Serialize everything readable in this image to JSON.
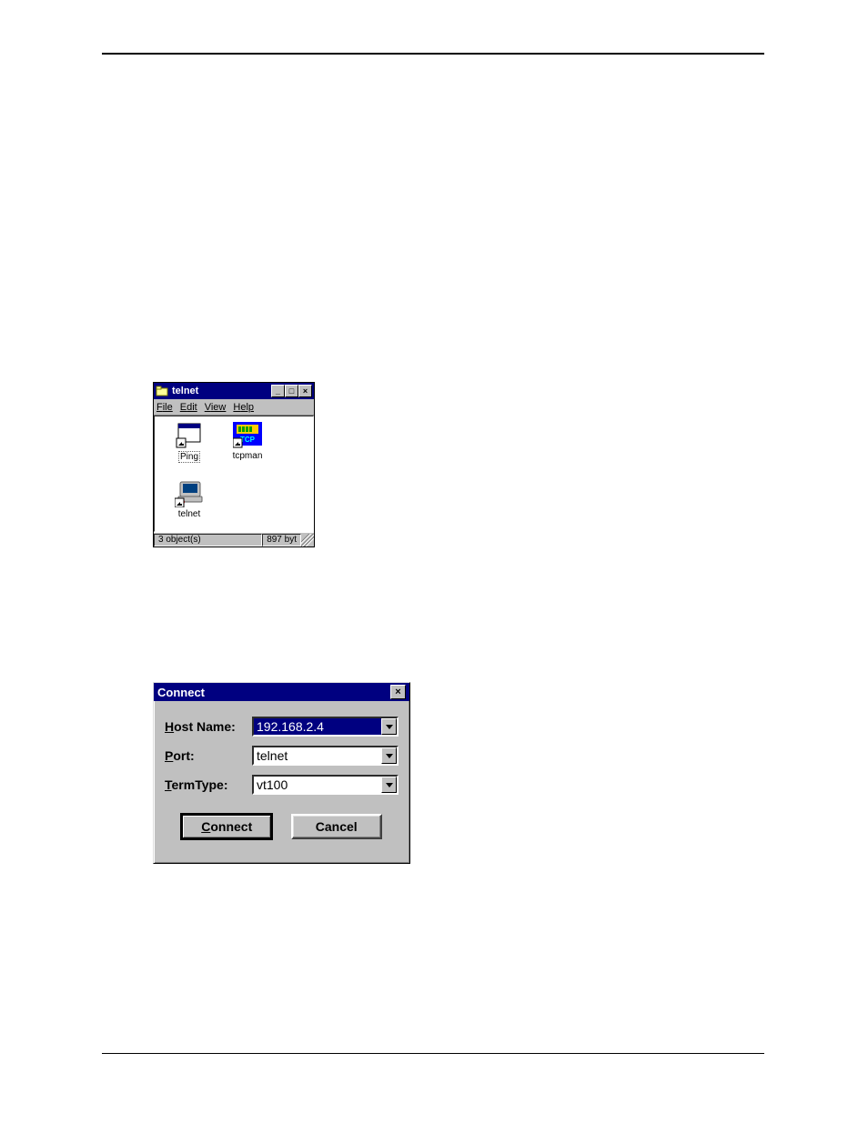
{
  "folder": {
    "title": "telnet",
    "menus": [
      {
        "accel": "F",
        "rest": "ile"
      },
      {
        "accel": "E",
        "rest": "dit"
      },
      {
        "accel": "V",
        "rest": "iew"
      },
      {
        "accel": "H",
        "rest": "elp"
      }
    ],
    "window_buttons": {
      "min": "_",
      "max": "□",
      "close": "×"
    },
    "items": [
      {
        "name": "Ping",
        "icon": "window-shortcut",
        "selected_label": true
      },
      {
        "name": "tcpman",
        "icon": "tcp-shortcut",
        "highlighted_icon": true
      },
      {
        "name": "telnet",
        "icon": "terminal-shortcut"
      }
    ],
    "status_left": "3 object(s)",
    "status_right": "897 byt"
  },
  "dialog": {
    "title": "Connect",
    "close_glyph": "×",
    "fields": {
      "host": {
        "label_accel": "H",
        "label_rest": "ost Name:",
        "value": "192.168.2.4",
        "selected": true
      },
      "port": {
        "label_accel": "P",
        "label_rest": "ort:",
        "value": "telnet"
      },
      "term": {
        "label_accel": "T",
        "label_rest": "ermType:",
        "value": "vt100"
      }
    },
    "buttons": {
      "connect": {
        "accel": "C",
        "rest": "onnect"
      },
      "cancel": {
        "text": "Cancel"
      }
    }
  }
}
